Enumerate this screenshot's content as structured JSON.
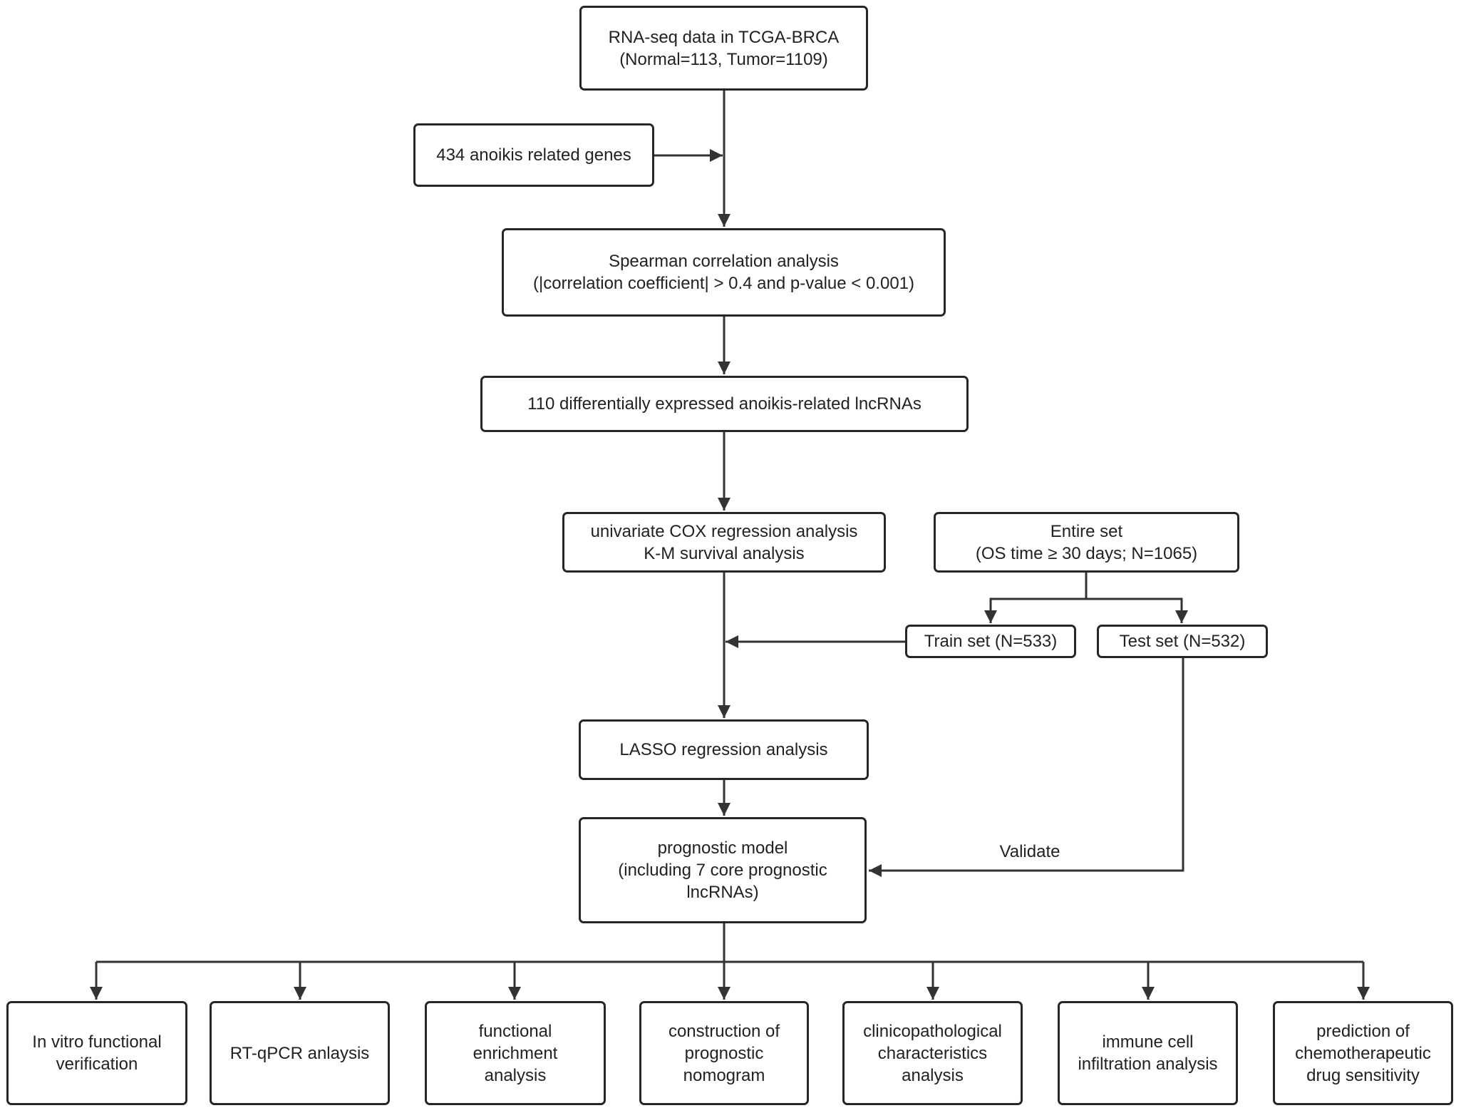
{
  "diagram": {
    "type": "flowchart",
    "nodes": {
      "rnaseq": {
        "text": "RNA-seq data in TCGA-BRCA\n(Normal=113, Tumor=1109)"
      },
      "genes": {
        "text": "434 anoikis related genes"
      },
      "spearman": {
        "text": "Spearman correlation analysis\n(|correlation coefficient| > 0.4 and p-value < 0.001)"
      },
      "lncrnas": {
        "text": "110 differentially expressed anoikis-related lncRNAs"
      },
      "cox": {
        "text": "univariate COX regression analysis\nK-M survival analysis"
      },
      "entire": {
        "text": "Entire set\n(OS time ≥ 30 days; N=1065)"
      },
      "train": {
        "text": "Train set (N=533)"
      },
      "test": {
        "text": "Test set (N=532)"
      },
      "lasso": {
        "text": "LASSO regression analysis"
      },
      "model": {
        "text": "prognostic model\n(including 7 core prognostic\nlncRNAs)"
      },
      "out1": {
        "text": "In vitro functional\nverification"
      },
      "out2": {
        "text": "RT-qPCR anlaysis"
      },
      "out3": {
        "text": "functional\nenrichment\nanalysis"
      },
      "out4": {
        "text": "construction of\nprognostic\nnomogram"
      },
      "out5": {
        "text": "clinicopathological\ncharacteristics\nanalysis"
      },
      "out6": {
        "text": "immune cell\ninfiltration analysis"
      },
      "out7": {
        "text": "prediction of\nchemotherapeutic\ndrug sensitivity"
      }
    },
    "edge_labels": {
      "validate": "Validate"
    },
    "edges": [
      {
        "from": "rnaseq",
        "to": "spearman"
      },
      {
        "from": "genes",
        "to": "rnaseq-spearman-link"
      },
      {
        "from": "spearman",
        "to": "lncrnas"
      },
      {
        "from": "lncrnas",
        "to": "cox"
      },
      {
        "from": "entire",
        "to": "train"
      },
      {
        "from": "entire",
        "to": "test"
      },
      {
        "from": "cox",
        "to": "lasso"
      },
      {
        "from": "train",
        "to": "cox-lasso-link"
      },
      {
        "from": "lasso",
        "to": "model"
      },
      {
        "from": "test",
        "to": "model",
        "label": "Validate"
      },
      {
        "from": "model",
        "to": "out1"
      },
      {
        "from": "model",
        "to": "out2"
      },
      {
        "from": "model",
        "to": "out3"
      },
      {
        "from": "model",
        "to": "out4"
      },
      {
        "from": "model",
        "to": "out5"
      },
      {
        "from": "model",
        "to": "out6"
      },
      {
        "from": "model",
        "to": "out7"
      }
    ]
  }
}
